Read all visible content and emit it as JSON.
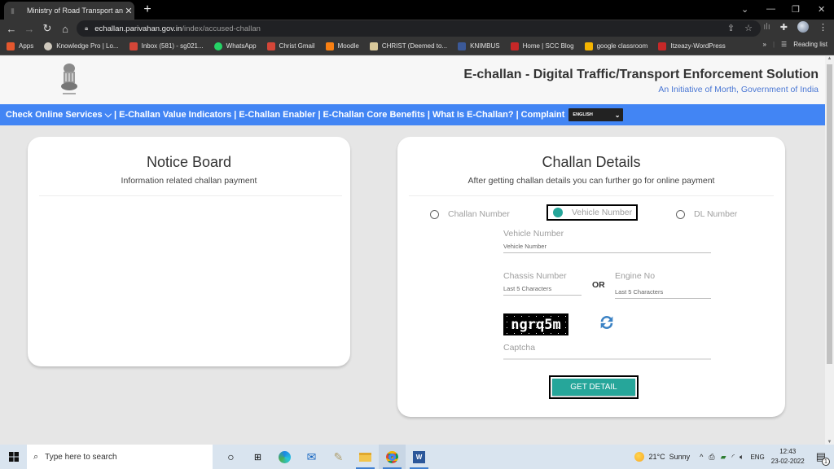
{
  "browser": {
    "tab_title": "Ministry of Road Transport and H",
    "url_domain": "echallan.parivahan.gov.in",
    "url_path": "/index/accused-challan",
    "bookmarks": [
      {
        "label": "Apps",
        "icon": "apps-grid-icon",
        "color": "#e4572e"
      },
      {
        "label": "Knowledge Pro | Lo...",
        "icon": "knowledge-pro-icon",
        "color": "#cfc9bd"
      },
      {
        "label": "Inbox (581) - sg021...",
        "icon": "gmail-icon",
        "color": "#d44638"
      },
      {
        "label": "WhatsApp",
        "icon": "whatsapp-icon",
        "color": "#25d366"
      },
      {
        "label": "Christ Gmail",
        "icon": "gmail-icon",
        "color": "#d44638"
      },
      {
        "label": "Moodle",
        "icon": "moodle-icon",
        "color": "#f98012"
      },
      {
        "label": "CHRIST (Deemed to...",
        "icon": "christ-icon",
        "color": "#d8c89a"
      },
      {
        "label": "KNIMBUS",
        "icon": "knimbus-icon",
        "color": "#3b5998"
      },
      {
        "label": "Home | SCC Blog",
        "icon": "scc-icon",
        "color": "#c62828"
      },
      {
        "label": "google classroom",
        "icon": "classroom-icon",
        "color": "#f4b400"
      },
      {
        "label": "Itzeazy-WordPress",
        "icon": "wordpress-icon",
        "color": "#c62828"
      }
    ],
    "reading_list": "Reading list",
    "more_bookmarks": "»"
  },
  "site": {
    "title": "E-challan - Digital Traffic/Transport Enforcement Solution",
    "subtitle": "An Initiative of Morth, Government of India",
    "nav": [
      "Check Online Services ⌵",
      "E-Challan Value Indicators",
      "E-Challan Enabler",
      "E-Challan Core Benefits",
      "What Is E-Challan?",
      "Complaint"
    ],
    "language": "ENGLISH"
  },
  "notice_board": {
    "title": "Notice Board",
    "subtitle": "Information related challan payment"
  },
  "challan_details": {
    "title": "Challan Details",
    "subtitle": "After getting challan details you can further go for online payment",
    "options": [
      {
        "label": "Challan Number",
        "selected": false
      },
      {
        "label": "Vehicle Number",
        "selected": true
      },
      {
        "label": "DL Number",
        "selected": false
      }
    ],
    "vehicle_label": "Vehicle Number",
    "vehicle_placeholder": "Vehicle Number",
    "chassis_label": "Chassis Number",
    "chassis_placeholder": "Last 5 Characters",
    "or_text": "OR",
    "engine_label": "Engine No",
    "engine_placeholder": "Last 5 Characters",
    "captcha_text": "ngrq5m",
    "captcha_label": "Captcha",
    "submit_label": "GET DETAIL",
    "accent": "#26a69a"
  },
  "taskbar": {
    "search_placeholder": "Type here to search",
    "weather": "21°C  Sunny",
    "language": "ENG",
    "time": "12:43",
    "date": "23-02-2022",
    "notification_count": "1"
  }
}
